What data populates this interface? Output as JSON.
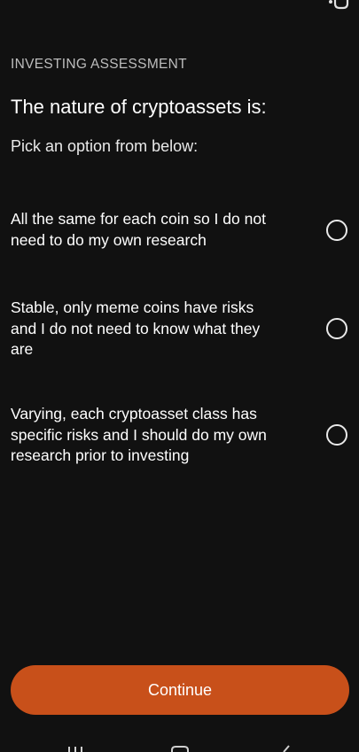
{
  "header": {
    "eyebrow": "INVESTING ASSESSMENT",
    "question": "The nature of cryptoassets is:",
    "instruction": "Pick an option from below:",
    "status_icon": "camera-icon"
  },
  "options": [
    {
      "label": "All the same for each coin so I do not need to do my own research",
      "selected": false
    },
    {
      "label": "Stable, only meme coins have risks and I do not need to know what they are",
      "selected": false
    },
    {
      "label": "Varying, each cryptoasset class has specific risks and I should do my own research prior to investing",
      "selected": false
    }
  ],
  "continue_button": {
    "label": "Continue"
  },
  "nav_bar": {
    "icons": [
      "recents-icon",
      "home-icon",
      "back-icon"
    ]
  },
  "colors": {
    "background": "#111111",
    "accent": "#c8501a",
    "text": "#ffffff",
    "muted_text": "#bdbdbd"
  }
}
